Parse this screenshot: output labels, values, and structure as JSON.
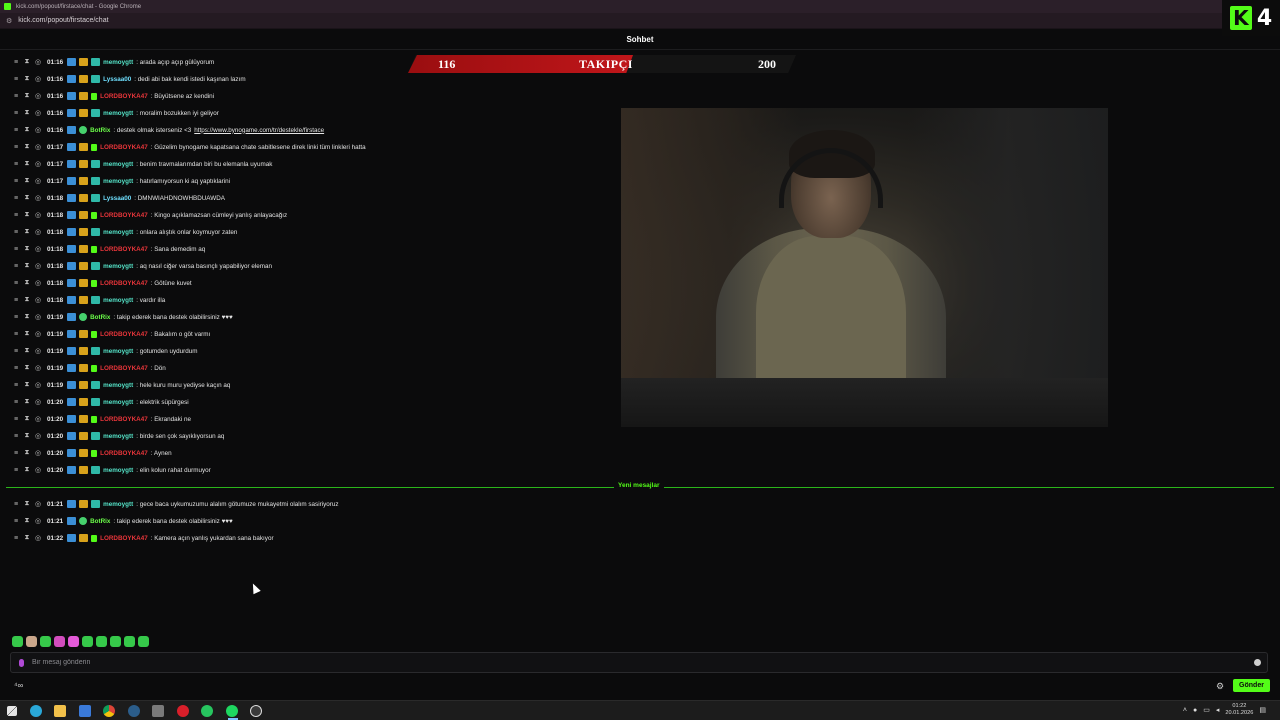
{
  "browser": {
    "window_title": "kick.com/popout/firstace/chat - Google Chrome",
    "url": "kick.com/popout/firstace/chat"
  },
  "kick_badge": {
    "logo": "K",
    "number": "4"
  },
  "chat_header": {
    "title": "Sohbet"
  },
  "follower_goal": {
    "current": "116",
    "label": "TAKIPÇI",
    "target": "200",
    "progress": 0.58,
    "fill_color": "#c0161a"
  },
  "messages": [
    {
      "time": "01:16",
      "badges": [
        "blue",
        "gold",
        "teal"
      ],
      "user": "memoygtt",
      "user_color": "teal",
      "text": ": arada açıp açıp gülüyorum"
    },
    {
      "time": "01:16",
      "badges": [
        "blue",
        "gold",
        "teal"
      ],
      "user": "Lyssaa00",
      "user_color": "cyan",
      "text": ": dedi abi bak kendi istedi kaşınan lazım"
    },
    {
      "time": "01:16",
      "badges": [
        "blue",
        "gold",
        "green"
      ],
      "user": "LORDBOYKA47",
      "user_color": "red",
      "text": ": Büyütsene az kendini"
    },
    {
      "time": "01:16",
      "badges": [
        "blue",
        "gold",
        "teal"
      ],
      "user": "memoygtt",
      "user_color": "teal",
      "text": ": moralim bozukken iyi geliyor"
    },
    {
      "time": "01:16",
      "badges": [
        "blue",
        "bot"
      ],
      "user": "BotRix",
      "user_color": "bot",
      "text": ": destek olmak isterseniz <3 ",
      "link": "https://www.bynogame.com/tr/destekle/firstace"
    },
    {
      "time": "01:17",
      "badges": [
        "blue",
        "gold",
        "green"
      ],
      "user": "LORDBOYKA47",
      "user_color": "red",
      "text": ": Güzelim bynogame kapatsana chate sabitlesene direk linki tüm linkleri hatta"
    },
    {
      "time": "01:17",
      "badges": [
        "blue",
        "gold",
        "teal"
      ],
      "user": "memoygtt",
      "user_color": "teal",
      "text": ": benim travmalarımdan biri bu elemanla uyumak"
    },
    {
      "time": "01:17",
      "badges": [
        "blue",
        "gold",
        "teal"
      ],
      "user": "memoygtt",
      "user_color": "teal",
      "text": ": hatırlamıyorsun ki aq yaptıklarini"
    },
    {
      "time": "01:18",
      "badges": [
        "blue",
        "gold",
        "teal"
      ],
      "user": "Lyssaa00",
      "user_color": "cyan",
      "text": ": DMNWIAHDNOWHBDUAWDA"
    },
    {
      "time": "01:18",
      "badges": [
        "blue",
        "gold",
        "green"
      ],
      "user": "LORDBOYKA47",
      "user_color": "red",
      "text": ": Kingo açıklamazsan cümleyi yanlış anlayacağız"
    },
    {
      "time": "01:18",
      "badges": [
        "blue",
        "gold",
        "teal"
      ],
      "user": "memoygtt",
      "user_color": "teal",
      "text": ": onlara alıştık onlar koymuyor zaten"
    },
    {
      "time": "01:18",
      "badges": [
        "blue",
        "gold",
        "green"
      ],
      "user": "LORDBOYKA47",
      "user_color": "red",
      "text": ": Sana demedim aq"
    },
    {
      "time": "01:18",
      "badges": [
        "blue",
        "gold",
        "teal"
      ],
      "user": "memoygtt",
      "user_color": "teal",
      "text": ": aq nasıl ciğer varsa basınçlı yapabiliyor eleman"
    },
    {
      "time": "01:18",
      "badges": [
        "blue",
        "gold",
        "green"
      ],
      "user": "LORDBOYKA47",
      "user_color": "red",
      "text": ": Götüne kuvet"
    },
    {
      "time": "01:18",
      "badges": [
        "blue",
        "gold",
        "teal"
      ],
      "user": "memoygtt",
      "user_color": "teal",
      "text": ": vardır illa"
    },
    {
      "time": "01:19",
      "badges": [
        "blue",
        "bot"
      ],
      "user": "BotRix",
      "user_color": "bot",
      "text": ": takip ederek bana destek olabilirsiniz ♥♥♥"
    },
    {
      "time": "01:19",
      "badges": [
        "blue",
        "gold",
        "green"
      ],
      "user": "LORDBOYKA47",
      "user_color": "red",
      "text": ": Bakalım o göt varmı"
    },
    {
      "time": "01:19",
      "badges": [
        "blue",
        "gold",
        "teal"
      ],
      "user": "memoygtt",
      "user_color": "teal",
      "text": ": gotumden uydurdum"
    },
    {
      "time": "01:19",
      "badges": [
        "blue",
        "gold",
        "green"
      ],
      "user": "LORDBOYKA47",
      "user_color": "red",
      "text": ": Dön"
    },
    {
      "time": "01:19",
      "badges": [
        "blue",
        "gold",
        "teal"
      ],
      "user": "memoygtt",
      "user_color": "teal",
      "text": ": hele kuru muru yediyse kaçın aq"
    },
    {
      "time": "01:20",
      "badges": [
        "blue",
        "gold",
        "teal"
      ],
      "user": "memoygtt",
      "user_color": "teal",
      "text": ": elektrik süpürgesi"
    },
    {
      "time": "01:20",
      "badges": [
        "blue",
        "gold",
        "green"
      ],
      "user": "LORDBOYKA47",
      "user_color": "red",
      "text": ": Ekrandaki ne"
    },
    {
      "time": "01:20",
      "badges": [
        "blue",
        "gold",
        "teal"
      ],
      "user": "memoygtt",
      "user_color": "teal",
      "text": ": birde sen çok sayıklıyorsun aq"
    },
    {
      "time": "01:20",
      "badges": [
        "blue",
        "gold",
        "green"
      ],
      "user": "LORDBOYKA47",
      "user_color": "red",
      "text": ": Aynen"
    },
    {
      "time": "01:20",
      "badges": [
        "blue",
        "gold",
        "teal"
      ],
      "user": "memoygtt",
      "user_color": "teal",
      "text": ": elin kolun rahat durmuyor"
    }
  ],
  "new_messages_label": "Yeni mesajlar",
  "new_messages": [
    {
      "time": "01:21",
      "badges": [
        "blue",
        "gold",
        "teal"
      ],
      "user": "memoygtt",
      "user_color": "teal",
      "text": ": gece baca uykumuzumu alalım götumuze mukayetmi olalım sasiriyoruz"
    },
    {
      "time": "01:21",
      "badges": [
        "blue",
        "bot"
      ],
      "user": "BotRix",
      "user_color": "bot",
      "text": ": takip ederek bana destek olabilirsiniz ♥♥♥"
    },
    {
      "time": "01:22",
      "badges": [
        "blue",
        "gold",
        "green"
      ],
      "user": "LORDBOYKA47",
      "user_color": "red",
      "text": ": Kamera açın yanlış yukardan sana bakıyor"
    }
  ],
  "emote_bar": [
    "emote-1",
    "emote-2",
    "emote-3",
    "emote-4",
    "emote-5",
    "emote-6",
    "emote-7",
    "emote-8",
    "emote-9",
    "emote-10"
  ],
  "input": {
    "placeholder": "Bir mesaj gönderin",
    "value": ""
  },
  "bottom_left_icons": "⁴∞",
  "send_button": "Gönder",
  "taskbar": {
    "clock_time": "01:22",
    "clock_date": "20.01.2026"
  }
}
